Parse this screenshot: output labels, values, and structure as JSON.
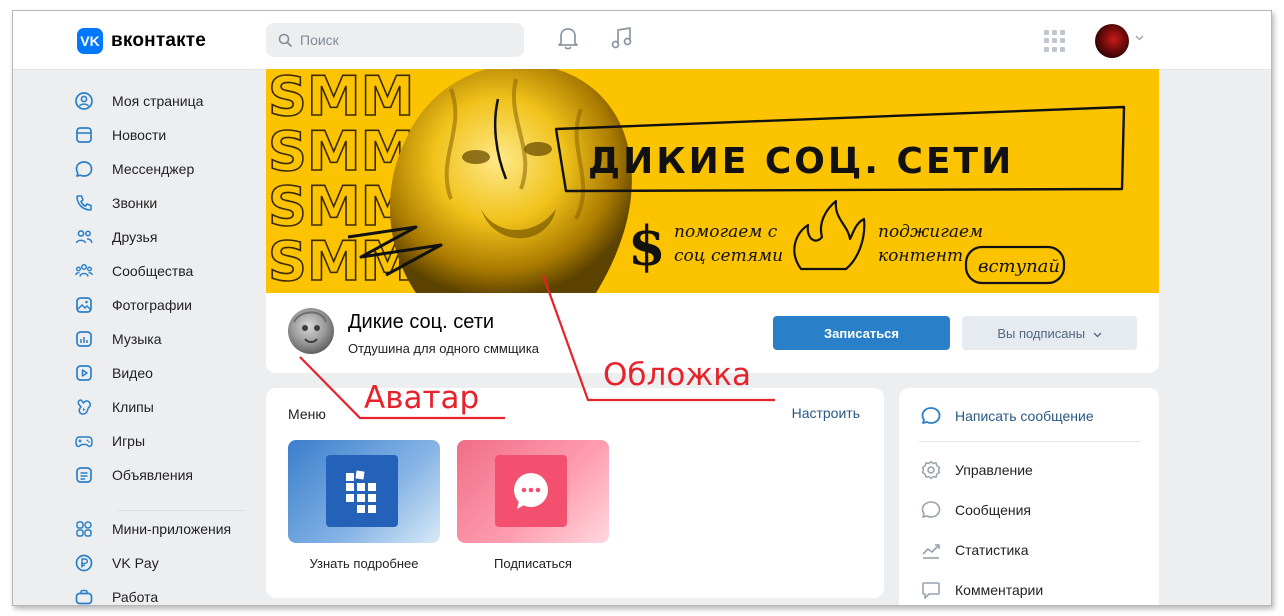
{
  "topbar": {
    "logo_glyph": "VK",
    "logo_text": "вконтакте",
    "search_placeholder": "Поиск",
    "icons": [
      "search-icon",
      "bell-icon",
      "music-icon",
      "apps-grid-icon",
      "chevron-down-icon"
    ]
  },
  "sidebar": {
    "items": [
      {
        "label": "Моя страница",
        "icon": "user-circle-icon"
      },
      {
        "label": "Новости",
        "icon": "news-icon"
      },
      {
        "label": "Мессенджер",
        "icon": "message-icon"
      },
      {
        "label": "Звонки",
        "icon": "phone-icon"
      },
      {
        "label": "Друзья",
        "icon": "friends-icon"
      },
      {
        "label": "Сообщества",
        "icon": "communities-icon"
      },
      {
        "label": "Фотографии",
        "icon": "photo-icon"
      },
      {
        "label": "Музыка",
        "icon": "music-note-icon"
      },
      {
        "label": "Видео",
        "icon": "video-icon"
      },
      {
        "label": "Клипы",
        "icon": "clips-icon"
      },
      {
        "label": "Игры",
        "icon": "gamepad-icon"
      },
      {
        "label": "Объявления",
        "icon": "ads-icon"
      },
      {
        "label": "Мини-приложения",
        "icon": "mini-apps-icon"
      },
      {
        "label": "VK Pay",
        "icon": "vkpay-icon"
      },
      {
        "label": "Работа",
        "icon": "briefcase-icon"
      }
    ]
  },
  "cover": {
    "smm": "SMM",
    "title": "ДИКИЕ СОЦ. СЕТИ",
    "feature1": [
      "помогаем с",
      "соц сетями"
    ],
    "feature2": [
      "поджигаем",
      "контент"
    ],
    "join": "вступай"
  },
  "group": {
    "name": "Дикие соц. сети",
    "status": "Отдушина для одного сммщика",
    "subscribe_label": "Записаться",
    "subscribed_label": "Вы подписаны"
  },
  "menu": {
    "title": "Меню",
    "settings": "Настроить",
    "tiles": [
      {
        "label": "Узнать подробнее",
        "icon": "info-grid-icon"
      },
      {
        "label": "Подписаться",
        "icon": "chat-bubble-icon"
      }
    ]
  },
  "actions": {
    "write": "Написать сообщение",
    "items": [
      {
        "label": "Управление",
        "icon": "gear-icon"
      },
      {
        "label": "Сообщения",
        "icon": "message-icon"
      },
      {
        "label": "Статистика",
        "icon": "chart-icon"
      },
      {
        "label": "Комментарии",
        "icon": "comment-icon"
      }
    ]
  },
  "annotations": {
    "avatar": "Аватар",
    "cover": "Обложка",
    "color": "#e8222b"
  },
  "colors": {
    "accent": "#2a80c8",
    "brand": "#0077ff",
    "cover_yellow": "#fcc400",
    "page_bg": "#edeef0"
  }
}
